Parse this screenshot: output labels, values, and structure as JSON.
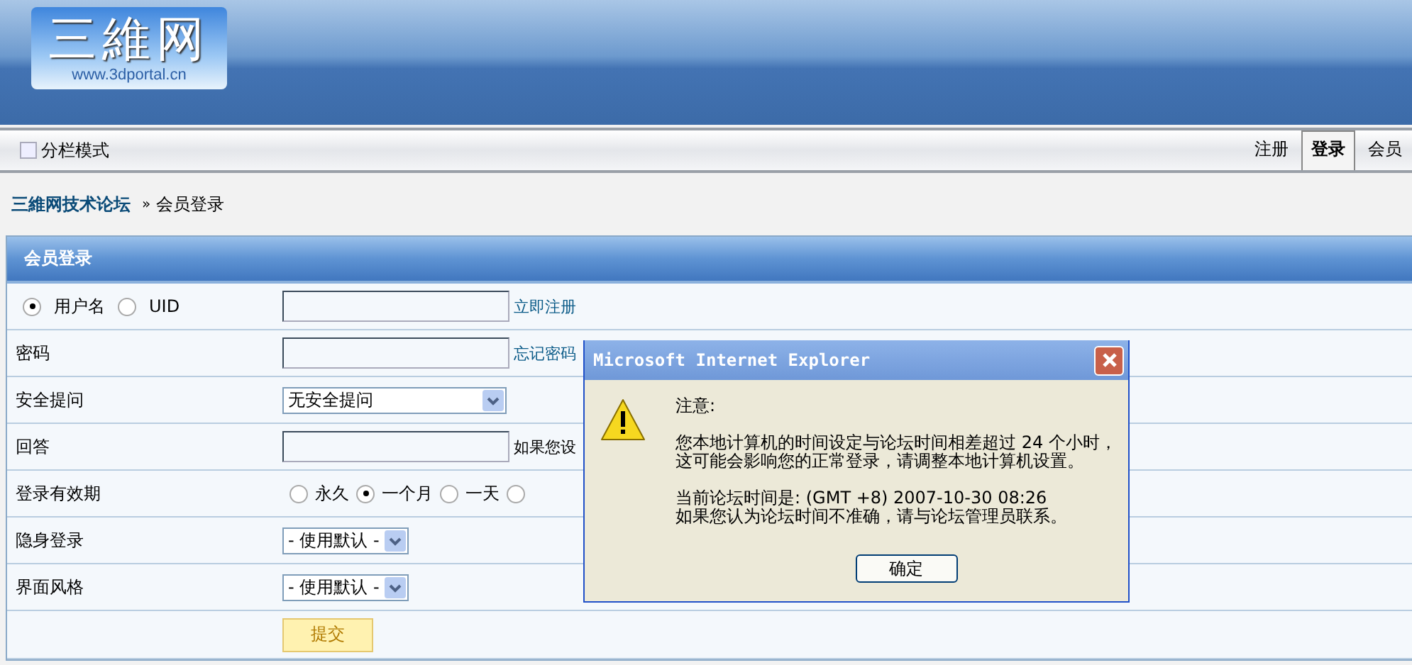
{
  "header": {
    "logo_title": "三維网",
    "logo_url": "www.3dportal.cn"
  },
  "toolbar": {
    "split_mode": {
      "label": "分栏模式",
      "checked": false
    },
    "tabs": [
      {
        "label": "注册",
        "selected": false
      },
      {
        "label": "登录",
        "selected": true
      },
      {
        "label": "会员",
        "selected": false
      }
    ]
  },
  "breadcrumb": {
    "forum": "三維网技术论坛",
    "separator": "»",
    "current": "会员登录"
  },
  "panel": {
    "title": "会员登录",
    "rows": [
      {
        "kind": "radio_input",
        "options": [
          {
            "label": "用户名",
            "selected": true
          },
          {
            "label": "UID",
            "selected": false
          }
        ],
        "value": "",
        "link": "立即注册"
      },
      {
        "kind": "input",
        "label": "密码",
        "value": "",
        "link": "忘记密码"
      },
      {
        "kind": "select",
        "label": "安全提问",
        "value": "无安全提问",
        "wide": true
      },
      {
        "kind": "input",
        "label": "回答",
        "value": "",
        "note": "如果您设"
      },
      {
        "kind": "radios",
        "label": "登录有效期",
        "options": [
          {
            "label": "永久",
            "selected": false
          },
          {
            "label": "一个月",
            "selected": true
          },
          {
            "label": "一天",
            "selected": false
          },
          {
            "selected": false
          }
        ]
      },
      {
        "kind": "select",
        "label": "隐身登录",
        "value": "- 使用默认 -",
        "wide": false
      },
      {
        "kind": "select",
        "label": "界面风格",
        "value": "- 使用默认 -",
        "wide": false
      },
      {
        "kind": "submit",
        "label": "提交"
      }
    ]
  },
  "dialog": {
    "title": "Microsoft Internet Explorer",
    "heading": "注意:",
    "lines": [
      "您本地计算机的时间设定与论坛时间相差超过 24 个小时，",
      "这可能会影响您的正常登录，请调整本地计算机设置。"
    ],
    "lines2": [
      "当前论坛时间是: (GMT +8) 2007-10-30 08:26",
      "如果您认为论坛时间不准确，请与论坛管理员联系。"
    ],
    "button": "确定"
  }
}
